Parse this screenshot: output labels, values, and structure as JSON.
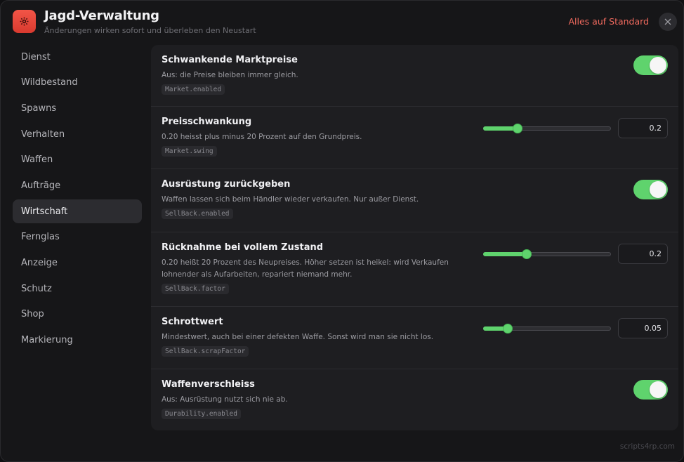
{
  "header": {
    "title": "Jagd-Verwaltung",
    "subtitle": "Änderungen wirken sofort und überleben den Neustart",
    "reset_label": "Alles auf Standard",
    "app_icon": "gear-icon",
    "close_icon": "close-icon"
  },
  "sidebar": {
    "items": [
      {
        "label": "Dienst"
      },
      {
        "label": "Wildbestand"
      },
      {
        "label": "Spawns"
      },
      {
        "label": "Verhalten"
      },
      {
        "label": "Waffen"
      },
      {
        "label": "Aufträge"
      },
      {
        "label": "Wirtschaft",
        "active": true
      },
      {
        "label": "Fernglas"
      },
      {
        "label": "Anzeige"
      },
      {
        "label": "Schutz"
      },
      {
        "label": "Shop"
      },
      {
        "label": "Markierung"
      }
    ]
  },
  "settings": {
    "rows": [
      {
        "title": "Schwankende Marktpreise",
        "desc": "Aus: die Preise bleiben immer gleich.",
        "key": "Market.enabled",
        "control": "toggle",
        "on": true
      },
      {
        "title": "Preisschwankung",
        "desc": "0.20 heisst plus minus 20 Prozent auf den Grundpreis.",
        "key": "Market.swing",
        "control": "slider",
        "value": "0.2",
        "slider_fraction": 0.27
      },
      {
        "title": "Ausrüstung zurückgeben",
        "desc": "Waffen lassen sich beim Händler wieder verkaufen. Nur außer Dienst.",
        "key": "SellBack.enabled",
        "control": "toggle",
        "on": true
      },
      {
        "title": "Rücknahme bei vollem Zustand",
        "desc": "0.20 heißt 20 Prozent des Neupreises. Höher setzen ist heikel: wird Verkaufen lohnender als Aufarbeiten, repariert niemand mehr.",
        "key": "SellBack.factor",
        "control": "slider",
        "value": "0.2",
        "slider_fraction": 0.34
      },
      {
        "title": "Schrottwert",
        "desc": "Mindestwert, auch bei einer defekten Waffe. Sonst wird man sie nicht los.",
        "key": "SellBack.scrapFactor",
        "control": "slider",
        "value": "0.05",
        "slider_fraction": 0.19
      },
      {
        "title": "Waffenverschleiss",
        "desc": "Aus: Ausrüstung nutzt sich nie ab.",
        "key": "Durability.enabled",
        "control": "toggle",
        "on": true
      }
    ]
  },
  "footer": {
    "watermark": "scripts4rp.com"
  },
  "colors": {
    "accent": "#5fd36d",
    "danger": "#f06a5e",
    "app_icon_bg": "#e8473b"
  }
}
